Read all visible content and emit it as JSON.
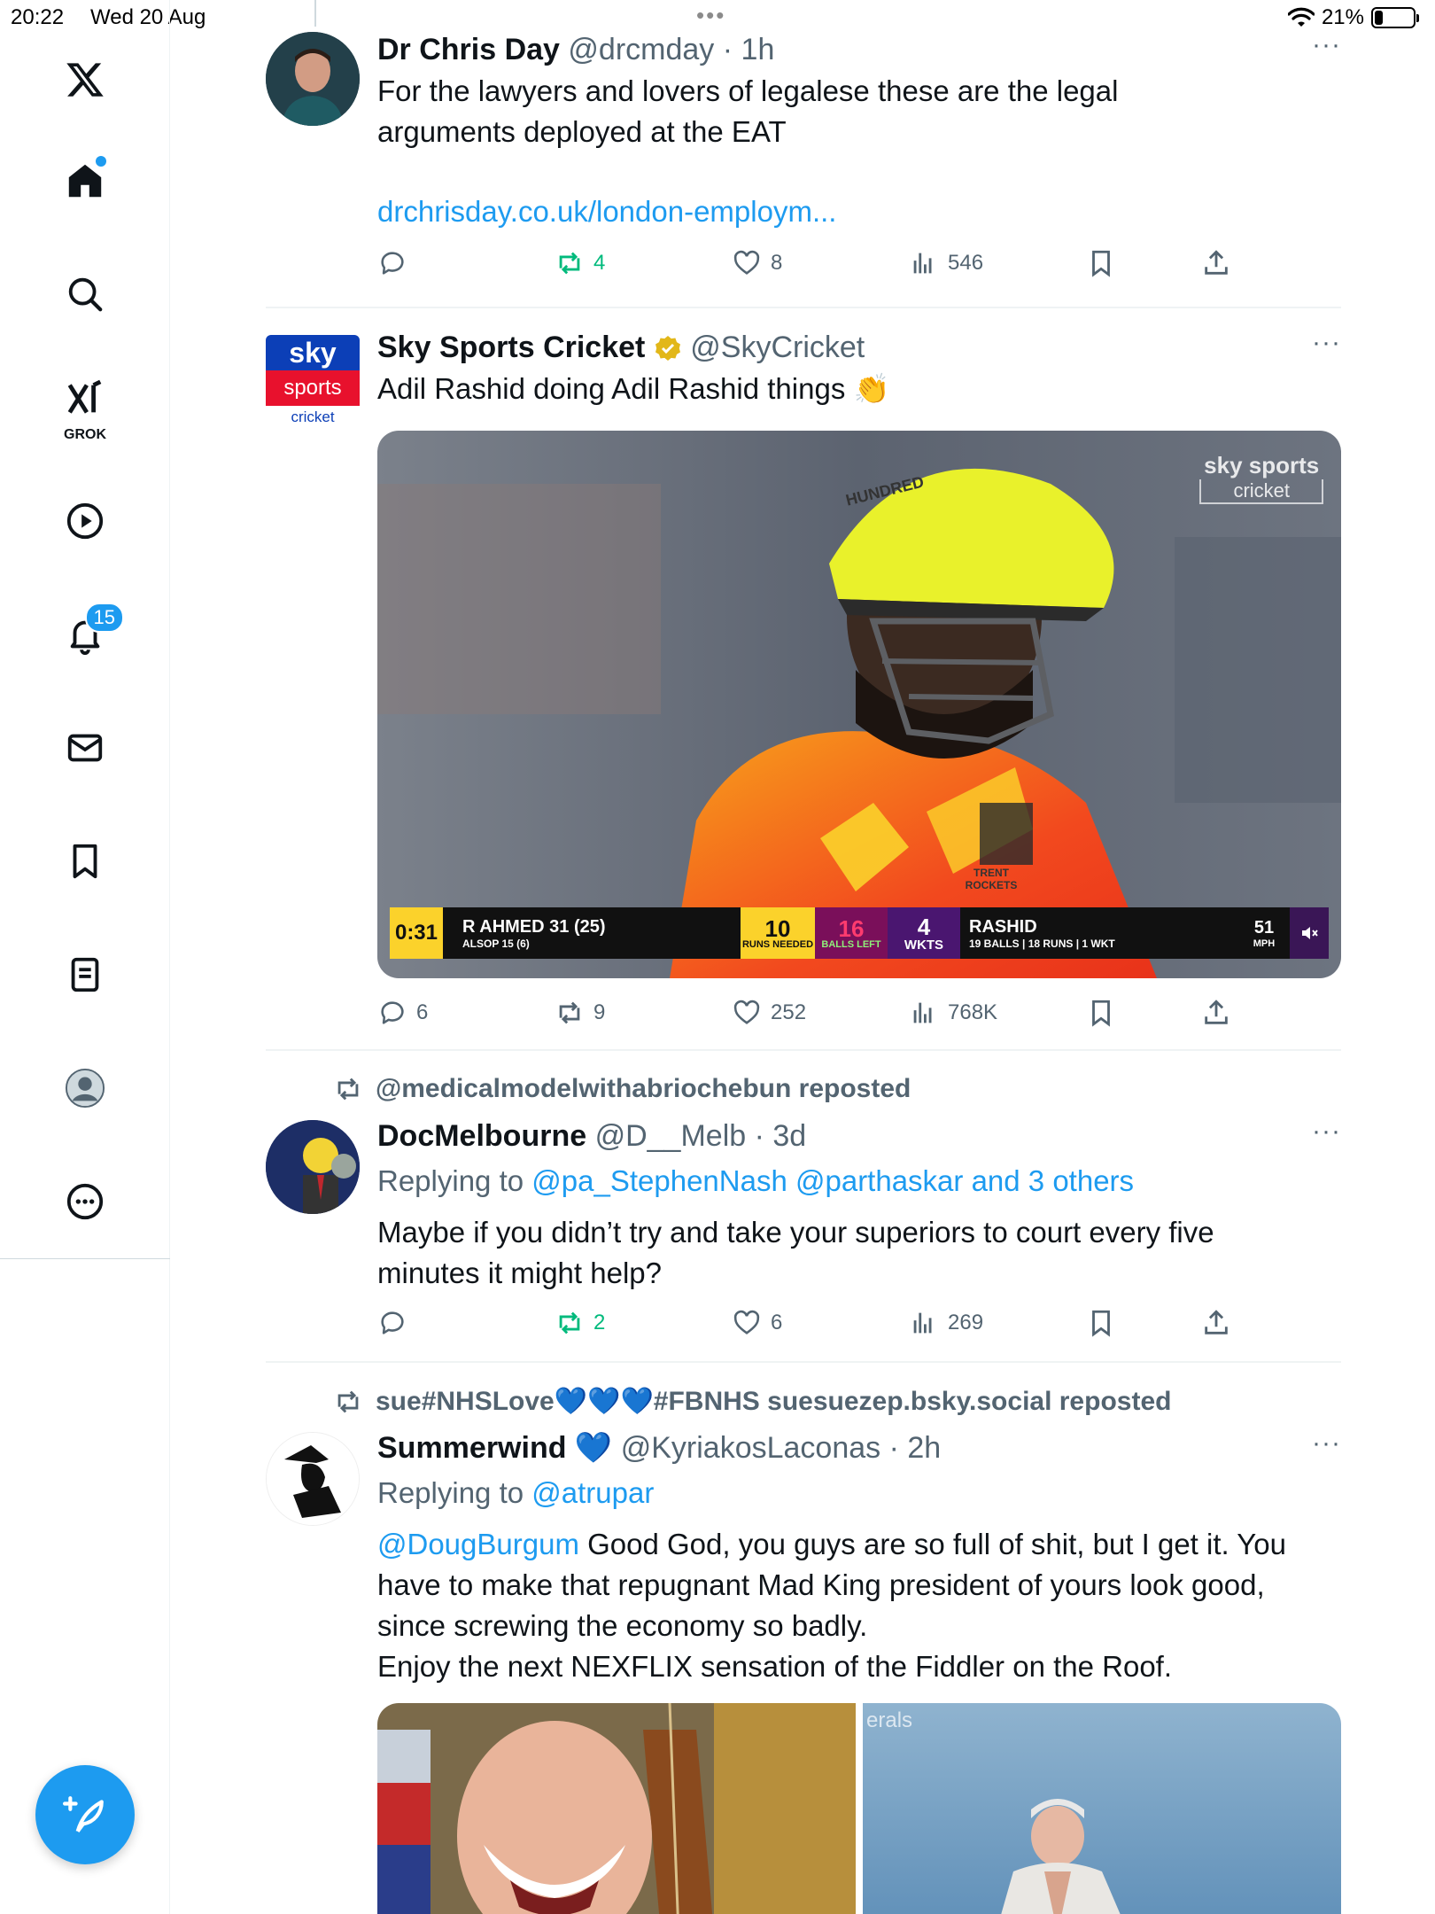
{
  "status": {
    "time": "20:22",
    "date": "Wed 20 Aug",
    "battery": "21%",
    "battery_level": 0.21
  },
  "sidebar": {
    "grok_label": "GROK",
    "notifications_count": "15"
  },
  "tweets": [
    {
      "name": "Dr Chris Day",
      "handle": "@drcmday",
      "time": "1h",
      "text": "For the lawyers and lovers of legalese these are the legal arguments deployed at the EAT",
      "link": "drchrisday.co.uk/london-employm...",
      "stats": {
        "replies": "",
        "reposts": "4",
        "likes": "8",
        "views": "546"
      }
    },
    {
      "name": "Sky Sports Cricket",
      "handle": "@SkyCricket",
      "text": "Adil Rashid doing Adil Rashid things 👏",
      "avatar_logo": {
        "top": "sky",
        "middle": "sports",
        "bottom": "cricket"
      },
      "video": {
        "time": "0:31",
        "watermark_top": "sky sports",
        "watermark_bottom": "cricket",
        "helmet_text": "HUNDRED",
        "shirt_text": "TRENT ROCKETS",
        "batter1": "R AHMED 31 (25)",
        "batter2": "ALSOP 15 (6)",
        "runs_needed": "10",
        "runs_needed_label": "RUNS NEEDED",
        "balls_left": "16",
        "balls_left_label": "BALLS LEFT",
        "wkts": "4",
        "wkts_label": "WKTS",
        "bowler": "RASHID",
        "bowler_stats": "19 BALLS | 18 RUNS | 1 WKT",
        "speed": "51",
        "speed_unit": "MPH"
      },
      "stats": {
        "replies": "6",
        "reposts": "9",
        "likes": "252",
        "views": "768K"
      }
    },
    {
      "repost_by": "@medicalmodelwithabriochebun reposted",
      "name": "DocMelbourne",
      "handle": "@D__Melb",
      "time": "3d",
      "replying_prefix": "Replying to",
      "replying_to": "@pa_StephenNash @parthaskar and 3 others",
      "text": "Maybe if you didn’t try and take your superiors to court every five minutes it might help?",
      "stats": {
        "replies": "",
        "reposts": "2",
        "likes": "6",
        "views": "269"
      }
    },
    {
      "repost_by": "sue#NHSLove💙💙💙#FBNHS suesuezep.bsky.social reposted",
      "name": "Summerwind 💙",
      "handle": "@KyriakosLaconas",
      "time": "2h",
      "replying_prefix": "Replying to",
      "replying_to": "@atrupar",
      "mention": "@DougBurgum",
      "text_rest": " Good God, you guys are so full of shit, but I get it. You have to make that repugnant Mad King president of yours look good, since screwing the economy so badly.",
      "text_line2": "Enjoy the next NEXFLIX sensation of the Fiddler on the Roof.",
      "image_right_caption": "erals"
    }
  ],
  "colors": {
    "accent": "#1d9bf0",
    "repost_green": "#00ba7c",
    "muted": "#536471",
    "text": "#0f1419"
  }
}
